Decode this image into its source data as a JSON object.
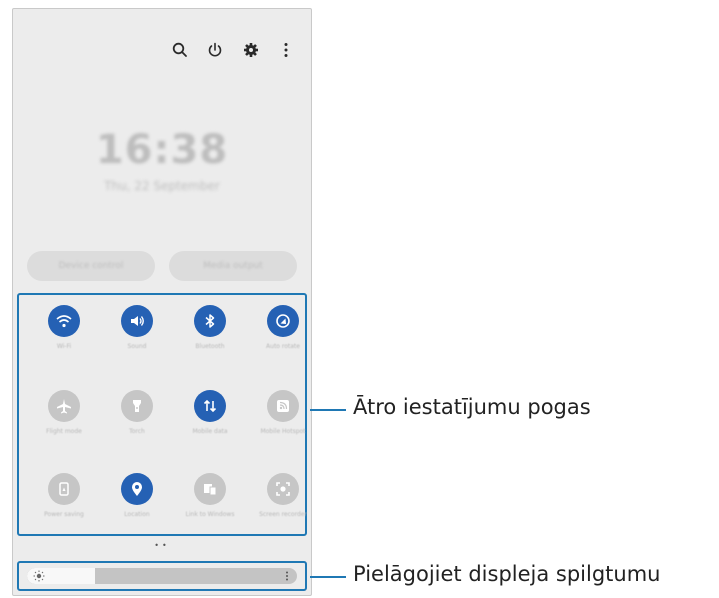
{
  "top_icons": [
    "search-icon",
    "power-icon",
    "gear-icon",
    "more-vertical-icon"
  ],
  "clock": {
    "time": "16:38",
    "date": "Thu, 22 September"
  },
  "pills": {
    "device_control": "Device control",
    "media_output": "Media output"
  },
  "tiles": [
    {
      "label": "Wi-Fi",
      "icon": "wifi-icon",
      "active": true
    },
    {
      "label": "Sound",
      "icon": "sound-icon",
      "active": true
    },
    {
      "label": "Bluetooth",
      "icon": "bluetooth-icon",
      "active": true
    },
    {
      "label": "Auto rotate",
      "icon": "auto-rotate-icon",
      "active": true
    },
    {
      "label": "Flight mode",
      "icon": "airplane-icon",
      "active": false
    },
    {
      "label": "Torch",
      "icon": "torch-icon",
      "active": false
    },
    {
      "label": "Mobile data",
      "icon": "mobile-data-icon",
      "active": true
    },
    {
      "label": "Mobile Hotspot",
      "icon": "hotspot-icon",
      "active": false
    },
    {
      "label": "Power saving",
      "icon": "power-saving-icon",
      "active": false
    },
    {
      "label": "Location",
      "icon": "location-icon",
      "active": true
    },
    {
      "label": "Link to Windows",
      "icon": "link-windows-icon",
      "active": false
    },
    {
      "label": "Screen recorder",
      "icon": "screen-recorder-icon",
      "active": false
    }
  ],
  "brightness": {
    "level_percent": 25
  },
  "colors": {
    "accent": "#2561b4",
    "callout": "#1f78b4"
  },
  "callouts": {
    "quick_settings": "Ātro iestatījumu pogas",
    "brightness": "Pielāgojiet displeja spilgtumu"
  }
}
